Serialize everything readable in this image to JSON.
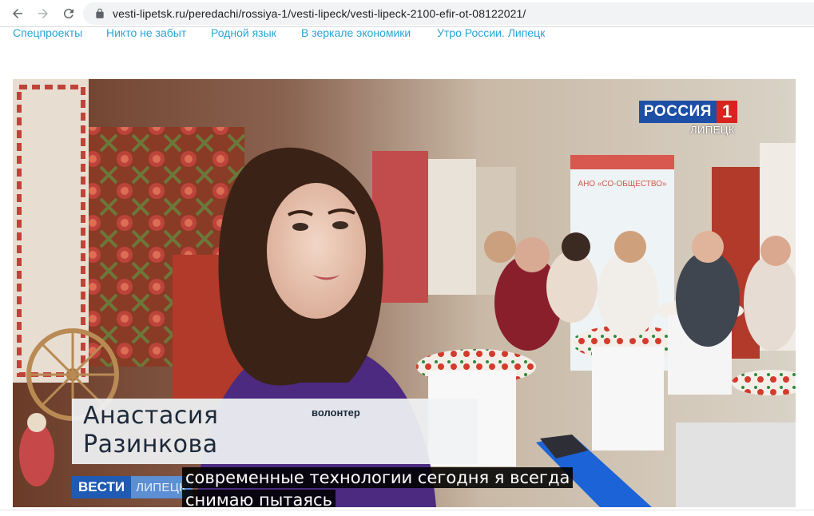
{
  "browser": {
    "url": "vesti-lipetsk.ru/peredachi/rossiya-1/vesti-lipeck/vesti-lipeck-2100-efir-ot-08122021/",
    "icons": [
      "back-arrow-icon",
      "forward-arrow-icon",
      "reload-icon",
      "lock-icon"
    ]
  },
  "site_nav": {
    "items": [
      {
        "label": "Спецпроекты"
      },
      {
        "label": "Никто не забыт"
      },
      {
        "label": "Родной язык"
      },
      {
        "label": "В зеркале экономики"
      },
      {
        "label": "Утро России. Липецк"
      }
    ],
    "link_color": "#2aa4d4"
  },
  "video": {
    "channel_logo": {
      "name": "РОССИЯ",
      "number": "1",
      "city": "ЛИПЕЦК"
    },
    "name_plate": {
      "first_name": "Анастасия",
      "last_name": "Разинкова",
      "role": "волонтер"
    },
    "program": {
      "name": "ВЕСТИ",
      "city": "ЛИПЕЦК"
    },
    "subtitles": [
      "современные технологии сегодня я всегда",
      "снимаю пытаясь"
    ],
    "scene_sign": "АНО «СО-ОБЩЕСТВО»"
  }
}
